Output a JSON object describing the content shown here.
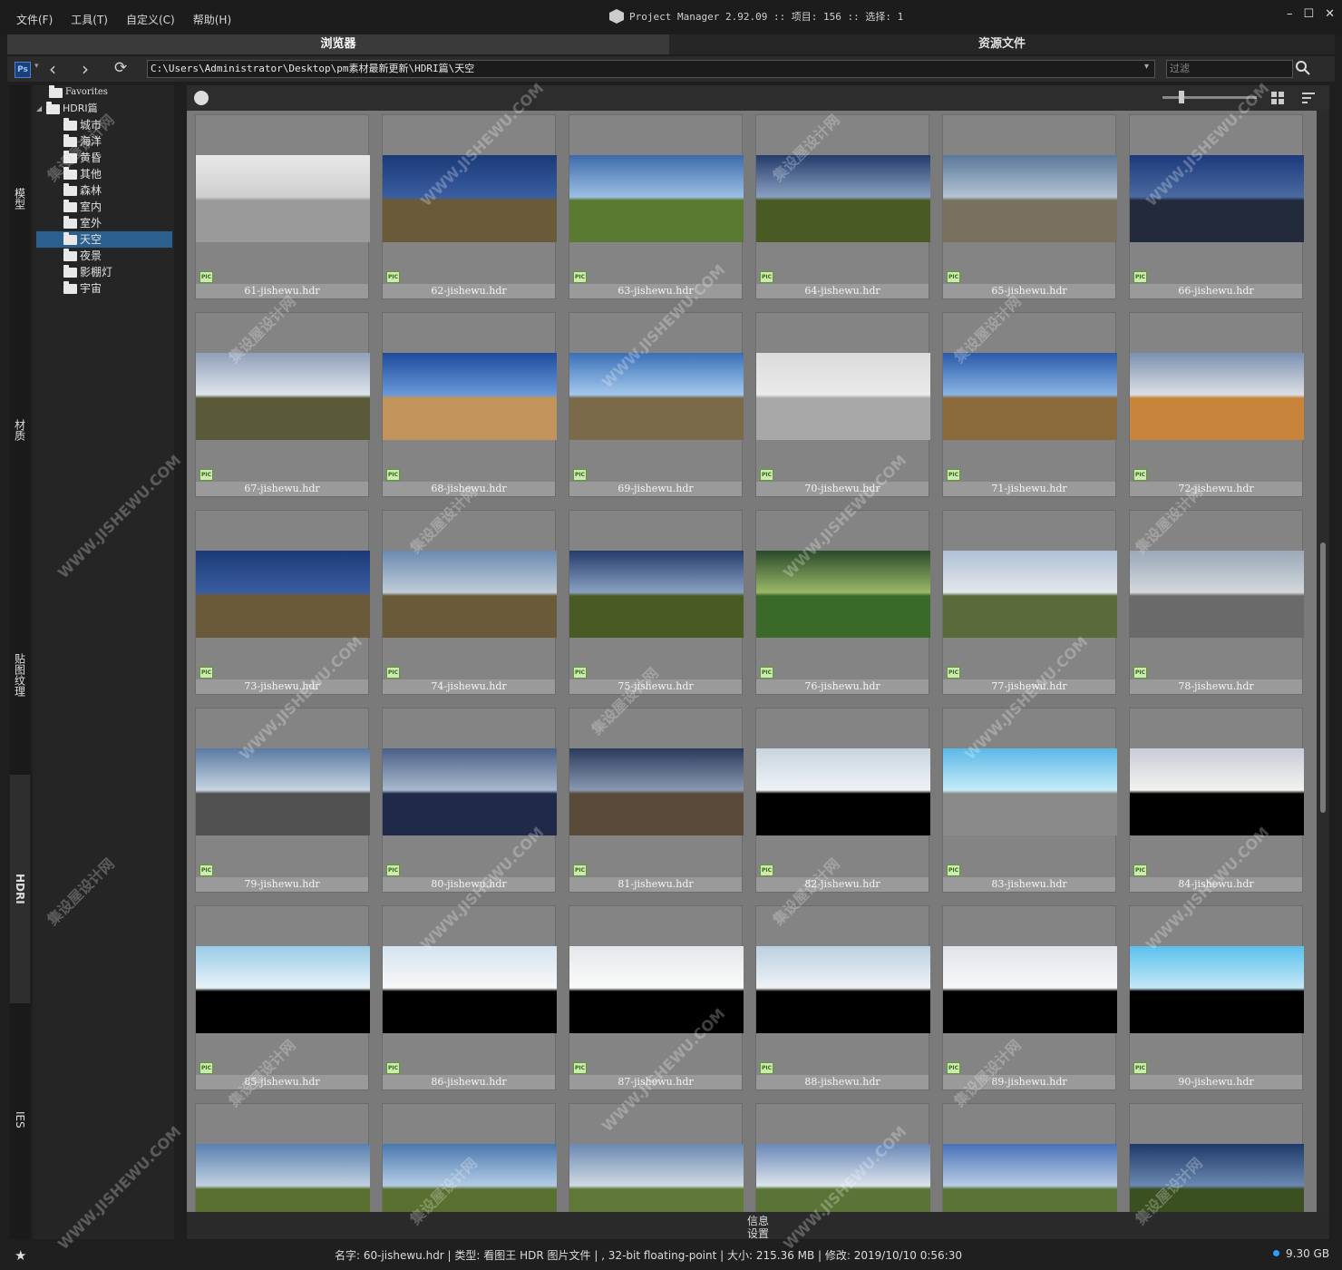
{
  "menu": [
    "文件(F)",
    "工具(T)",
    "自定义(C)",
    "帮助(H)"
  ],
  "window": {
    "title": "Project Manager 2.92.09  :: 项目: 156  :: 选择: 1"
  },
  "tabs": {
    "browser": "浏览器",
    "assets": "资源文件"
  },
  "pathbar": {
    "path": "C:\\Users\\Administrator\\Desktop\\pm素材最新更新\\HDRI篇\\天空",
    "filter_placeholder": "过滤",
    "ps_badge": "Ps"
  },
  "sidetabs": [
    "模型",
    "材质",
    "贴图纹理",
    "HDRI",
    "IES"
  ],
  "tree": {
    "favorites": "Favorites",
    "root": "HDRI篇",
    "folders": [
      "城市",
      "海洋",
      "黄昏",
      "其他",
      "森林",
      "室内",
      "室外",
      "天空",
      "夜景",
      "影棚灯",
      "宇宙"
    ],
    "selected": "天空"
  },
  "grid": {
    "badge": "PIC",
    "items": [
      "61-jishewu.hdr",
      "62-jishewu.hdr",
      "63-jishewu.hdr",
      "64-jishewu.hdr",
      "65-jishewu.hdr",
      "66-jishewu.hdr",
      "67-jishewu.hdr",
      "68-jishewu.hdr",
      "69-jishewu.hdr",
      "70-jishewu.hdr",
      "71-jishewu.hdr",
      "72-jishewu.hdr",
      "73-jishewu.hdr",
      "74-jishewu.hdr",
      "75-jishewu.hdr",
      "76-jishewu.hdr",
      "77-jishewu.hdr",
      "78-jishewu.hdr",
      "79-jishewu.hdr",
      "80-jishewu.hdr",
      "81-jishewu.hdr",
      "82-jishewu.hdr",
      "83-jishewu.hdr",
      "84-jishewu.hdr",
      "85-jishewu.hdr",
      "86-jishewu.hdr",
      "87-jishewu.hdr",
      "88-jishewu.hdr",
      "89-jishewu.hdr",
      "90-jishewu.hdr",
      "",
      "",
      "",
      "",
      "",
      ""
    ]
  },
  "infopanel": {
    "info": "信息",
    "settings": "设置"
  },
  "status": {
    "text": "名字: 60-jishewu.hdr | 类型: 看图王 HDR 图片文件 | , 32-bit floating-point | 大小: 215.36 MB | 修改: 2019/10/10 0:56:30",
    "disk": "9.30 GB"
  },
  "watermark": {
    "cn": "集设屋设计网",
    "url": "WWW.JISHEWU.COM"
  },
  "colors": {
    "accent": "#2b5f8e",
    "disk_dot": "#2aa0ff"
  }
}
